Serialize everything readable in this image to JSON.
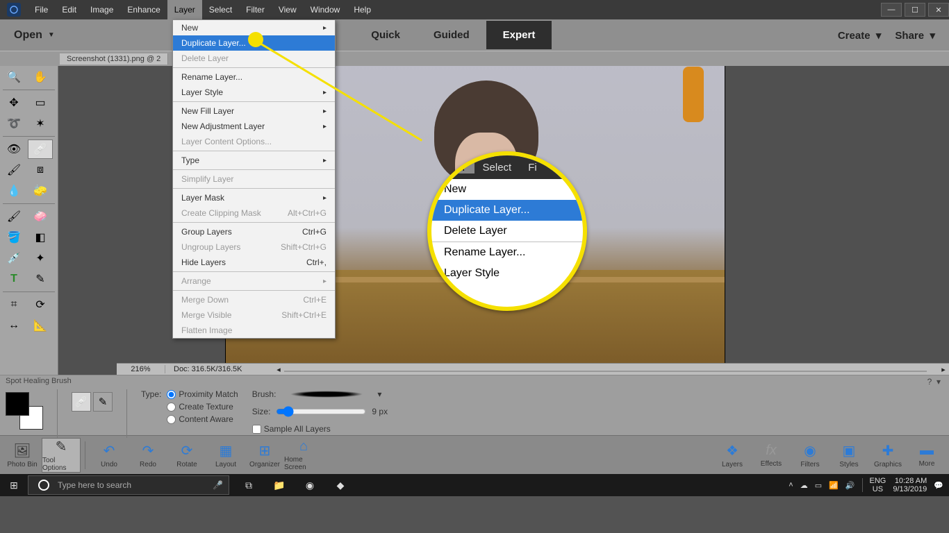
{
  "menu": {
    "items": [
      "File",
      "Edit",
      "Image",
      "Enhance",
      "Layer",
      "Select",
      "Filter",
      "View",
      "Window",
      "Help"
    ],
    "active": "Layer"
  },
  "modebar": {
    "open": "Open",
    "modes": [
      "Quick",
      "Guided",
      "Expert"
    ],
    "active": "Expert",
    "create": "Create",
    "share": "Share"
  },
  "tab": {
    "title": "Screenshot (1331).png @ 2"
  },
  "dropdown": {
    "items": [
      {
        "label": "New",
        "submenu": true
      },
      {
        "label": "Duplicate Layer...",
        "highlight": true
      },
      {
        "label": "Delete Layer",
        "disabled": true
      },
      {
        "sep": true
      },
      {
        "label": "Rename Layer..."
      },
      {
        "label": "Layer Style",
        "submenu": true
      },
      {
        "sep": true
      },
      {
        "label": "New Fill Layer",
        "submenu": true
      },
      {
        "label": "New Adjustment Layer",
        "submenu": true
      },
      {
        "label": "Layer Content Options...",
        "disabled": true
      },
      {
        "sep": true
      },
      {
        "label": "Type",
        "submenu": true
      },
      {
        "sep": true
      },
      {
        "label": "Simplify Layer",
        "disabled": true
      },
      {
        "sep": true
      },
      {
        "label": "Layer Mask",
        "submenu": true
      },
      {
        "label": "Create Clipping Mask",
        "shortcut": "Alt+Ctrl+G",
        "disabled": true
      },
      {
        "sep": true
      },
      {
        "label": "Group Layers",
        "shortcut": "Ctrl+G"
      },
      {
        "label": "Ungroup Layers",
        "shortcut": "Shift+Ctrl+G",
        "disabled": true
      },
      {
        "label": "Hide Layers",
        "shortcut": "Ctrl+,"
      },
      {
        "sep": true
      },
      {
        "label": "Arrange",
        "submenu": true,
        "disabled": true
      },
      {
        "sep": true
      },
      {
        "label": "Merge Down",
        "shortcut": "Ctrl+E",
        "disabled": true
      },
      {
        "label": "Merge Visible",
        "shortcut": "Shift+Ctrl+E",
        "disabled": true
      },
      {
        "label": "Flatten Image",
        "disabled": true
      }
    ]
  },
  "callout": {
    "menubar": [
      "Layer",
      "Select",
      "Fi"
    ],
    "items": [
      "New",
      "Duplicate Layer...",
      "Delete Layer"
    ],
    "rename": "Rename Layer...",
    "style": "Layer Style"
  },
  "zoombar": {
    "zoom": "216%",
    "doc": "Doc: 316.5K/316.5K"
  },
  "options": {
    "title": "Spot Healing Brush",
    "type_label": "Type:",
    "radios": [
      "Proximity Match",
      "Create Texture",
      "Content Aware"
    ],
    "brush_label": "Brush:",
    "size_label": "Size:",
    "size_val": "9 px",
    "sample": "Sample All Layers"
  },
  "panels": {
    "left": [
      "Photo Bin",
      "Tool Options",
      "Undo",
      "Redo",
      "Rotate",
      "Layout",
      "Organizer",
      "Home Screen"
    ],
    "right": [
      "Layers",
      "Effects",
      "Filters",
      "Styles",
      "Graphics",
      "More"
    ]
  },
  "taskbar": {
    "search_placeholder": "Type here to search",
    "lang": "ENG",
    "locale": "US",
    "time": "10:28 AM",
    "date": "9/13/2019"
  },
  "colors": {
    "accent_yellow": "#f5e000",
    "highlight_blue": "#2d7bd6"
  }
}
